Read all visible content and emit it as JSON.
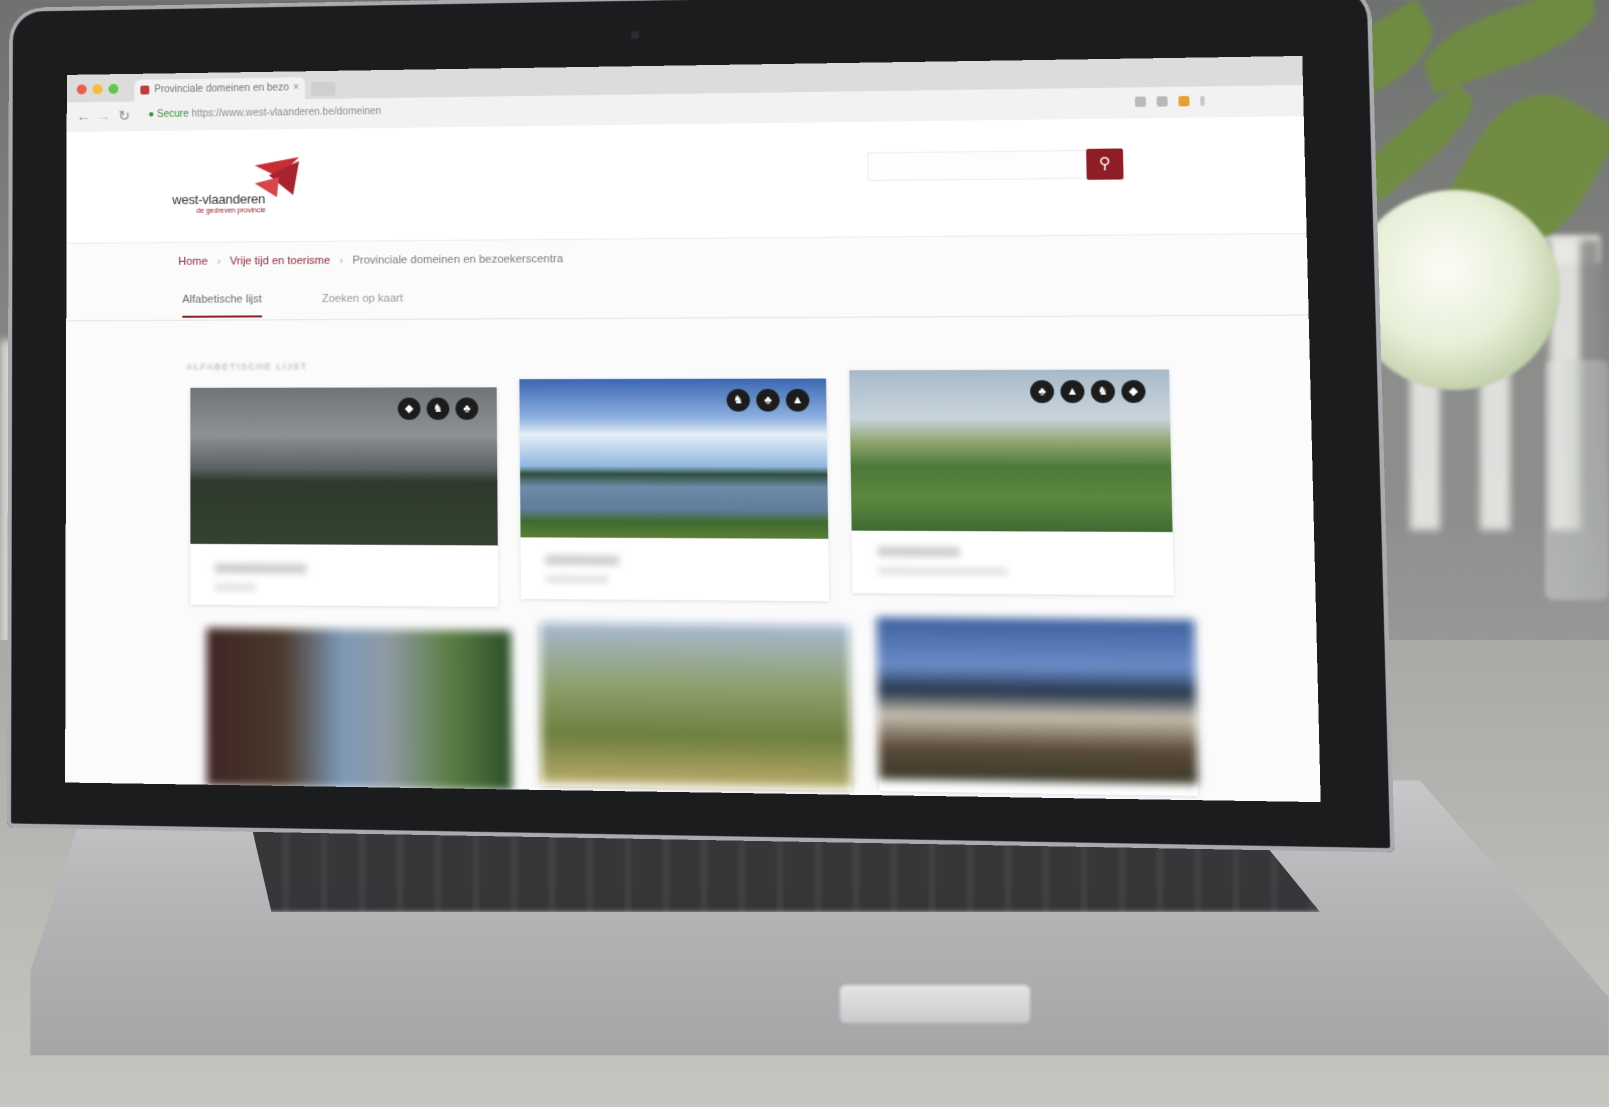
{
  "browser": {
    "tab_title": "Provinciale domeinen en bezo",
    "tab_close": "×",
    "url_secure": "Secure",
    "url_rest": "https://www.west-vlaanderen.be/domeinen"
  },
  "site": {
    "logo_text": "west-vlaanderen",
    "logo_sub": "de gedreven provincie",
    "search_icon": "search-icon",
    "search_glyph": "⚲"
  },
  "breadcrumb": {
    "home": "Home",
    "level2": "Vrije tijd en toerisme",
    "current": "Provinciale domeinen en bezoekerscentra",
    "sep": "›"
  },
  "tabs": {
    "active": "Alfabetische lijst",
    "inactive": "Zoeken op kaart"
  },
  "section": {
    "label": "ALFABETISCHE LIJST"
  },
  "colors": {
    "brand": "#8f1d26",
    "link": "#8c2b3a"
  }
}
